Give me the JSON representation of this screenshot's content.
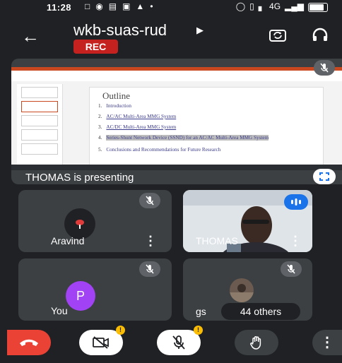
{
  "status_bar": {
    "time": "11:28",
    "network": "4G"
  },
  "header": {
    "meeting_code": "wkb-suas-rud",
    "rec_label": "REC"
  },
  "presentation": {
    "slide_title": "Outline",
    "items": [
      {
        "num": "1.",
        "text": "Introduction"
      },
      {
        "num": "2.",
        "text": "AC/AC Multi-Area MMG System"
      },
      {
        "num": "3.",
        "text": "AC/DC Multi-Area MMG System"
      },
      {
        "num": "4.",
        "text": "Series-Shunt Network Device (SSND) for an AC/AC Multi-Area MMG System"
      },
      {
        "num": "5.",
        "text": "Conclusions and Recommendations for Future Research"
      }
    ],
    "presenting_label": "THOMAS is presenting"
  },
  "participants": {
    "aravind": {
      "name": "Aravind"
    },
    "thomas": {
      "name": "THOMAS"
    },
    "you": {
      "name": "You",
      "initial": "P"
    },
    "others": {
      "name": "gs",
      "others_label": "44 others"
    }
  },
  "controls": {
    "camera_badge": "!",
    "mic_badge": "!"
  },
  "colors": {
    "background": "#202124",
    "tile": "#3c4043",
    "rec": "#c5221f",
    "end_call": "#ea4335",
    "avatar_you": "#a142f4",
    "speaking_indicator": "#1a73e8",
    "warning_badge": "#fbbc04"
  }
}
